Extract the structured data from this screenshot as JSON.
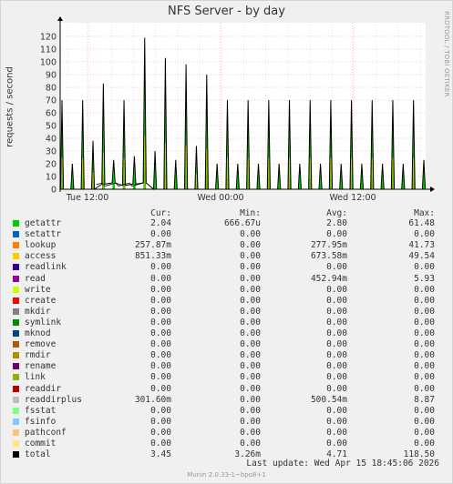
{
  "title": "NFS Server - by day",
  "side_text": "RRDTOOL / TOBI OETIKER",
  "ylabel": "requests / second",
  "headers": {
    "cur": "Cur:",
    "min": "Min:",
    "avg": "Avg:",
    "max": "Max:"
  },
  "last_update": "Last update: Wed Apr 15 18:45:06 2026",
  "footer": "Munin 2.0.33-1~bpo8+1",
  "chart_data": {
    "type": "line",
    "title": "NFS Server - by day",
    "ylabel": "requests / second",
    "ylim": [
      0,
      125
    ],
    "yticks": [
      0,
      10,
      20,
      30,
      40,
      50,
      60,
      70,
      80,
      90,
      100,
      110,
      120
    ],
    "x_tick_labels": [
      "Tue 12:00",
      "Wed 00:00",
      "Wed 12:00"
    ],
    "grid": true,
    "total_spikes": [
      70,
      20,
      70,
      38,
      83,
      23,
      70,
      26,
      119,
      30,
      103,
      23,
      98,
      34,
      90,
      20,
      70,
      20,
      70,
      20,
      70,
      20,
      70,
      20,
      70,
      20,
      70,
      20,
      70,
      20,
      70,
      20,
      70,
      20,
      70,
      23
    ],
    "total_baseline_note": "near 0 except ~2-5 between Tue 12:00 and ~Tue 18:00"
  },
  "legend": [
    {
      "name": "getattr",
      "color": "#00cc00",
      "cur": "2.04",
      "min": "666.67u",
      "avg": "2.80",
      "max": "61.48"
    },
    {
      "name": "setattr",
      "color": "#0066b3",
      "cur": "0.00",
      "min": "0.00",
      "avg": "0.00",
      "max": "0.00"
    },
    {
      "name": "lookup",
      "color": "#ff8000",
      "cur": "257.87m",
      "min": "0.00",
      "avg": "277.95m",
      "max": "41.73"
    },
    {
      "name": "access",
      "color": "#ffcc00",
      "cur": "851.33m",
      "min": "0.00",
      "avg": "673.58m",
      "max": "49.54"
    },
    {
      "name": "readlink",
      "color": "#330099",
      "cur": "0.00",
      "min": "0.00",
      "avg": "0.00",
      "max": "0.00"
    },
    {
      "name": "read",
      "color": "#990099",
      "cur": "0.00",
      "min": "0.00",
      "avg": "452.94m",
      "max": "5.93"
    },
    {
      "name": "write",
      "color": "#ccff00",
      "cur": "0.00",
      "min": "0.00",
      "avg": "0.00",
      "max": "0.00"
    },
    {
      "name": "create",
      "color": "#ff0000",
      "cur": "0.00",
      "min": "0.00",
      "avg": "0.00",
      "max": "0.00"
    },
    {
      "name": "mkdir",
      "color": "#808080",
      "cur": "0.00",
      "min": "0.00",
      "avg": "0.00",
      "max": "0.00"
    },
    {
      "name": "symlink",
      "color": "#008f00",
      "cur": "0.00",
      "min": "0.00",
      "avg": "0.00",
      "max": "0.00"
    },
    {
      "name": "mknod",
      "color": "#00487d",
      "cur": "0.00",
      "min": "0.00",
      "avg": "0.00",
      "max": "0.00"
    },
    {
      "name": "remove",
      "color": "#b35a00",
      "cur": "0.00",
      "min": "0.00",
      "avg": "0.00",
      "max": "0.00"
    },
    {
      "name": "rmdir",
      "color": "#b38f00",
      "cur": "0.00",
      "min": "0.00",
      "avg": "0.00",
      "max": "0.00"
    },
    {
      "name": "rename",
      "color": "#6b006b",
      "cur": "0.00",
      "min": "0.00",
      "avg": "0.00",
      "max": "0.00"
    },
    {
      "name": "link",
      "color": "#8fb300",
      "cur": "0.00",
      "min": "0.00",
      "avg": "0.00",
      "max": "0.00"
    },
    {
      "name": "readdir",
      "color": "#b30000",
      "cur": "0.00",
      "min": "0.00",
      "avg": "0.00",
      "max": "0.00"
    },
    {
      "name": "readdirplus",
      "color": "#bebebe",
      "cur": "301.60m",
      "min": "0.00",
      "avg": "500.54m",
      "max": "8.87"
    },
    {
      "name": "fsstat",
      "color": "#80ff80",
      "cur": "0.00",
      "min": "0.00",
      "avg": "0.00",
      "max": "0.00"
    },
    {
      "name": "fsinfo",
      "color": "#80c9ff",
      "cur": "0.00",
      "min": "0.00",
      "avg": "0.00",
      "max": "0.00"
    },
    {
      "name": "pathconf",
      "color": "#ffc080",
      "cur": "0.00",
      "min": "0.00",
      "avg": "0.00",
      "max": "0.00"
    },
    {
      "name": "commit",
      "color": "#ffe680",
      "cur": "0.00",
      "min": "0.00",
      "avg": "0.00",
      "max": "0.00"
    },
    {
      "name": "total",
      "color": "#000000",
      "cur": "3.45",
      "min": "3.26m",
      "avg": "4.71",
      "max": "118.50"
    }
  ]
}
